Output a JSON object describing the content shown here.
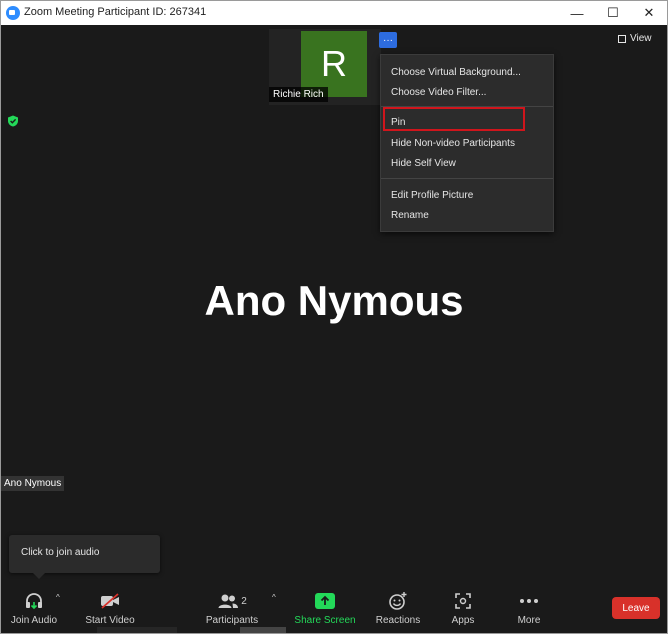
{
  "window": {
    "title": "Zoom Meeting Participant ID: 267341",
    "controls": {
      "minimize": "—",
      "maximize": "☐",
      "close": "✕"
    }
  },
  "thumbnail": {
    "initial": "R",
    "name": "Richie Rich",
    "more_glyph": "···",
    "tile_color": "#39731f"
  },
  "view_button": {
    "label": "View"
  },
  "context_menu": {
    "items": [
      "Choose Virtual Background...",
      "Choose Video Filter...",
      "Pin",
      "Hide Non-video Participants",
      "Hide Self View",
      "Edit Profile Picture",
      "Rename"
    ],
    "highlight_color": "#d0151c"
  },
  "main_speaker": {
    "name": "Ano Nymous"
  },
  "self_view": {
    "label": "Ano Nymous"
  },
  "audio_tooltip": {
    "text": "Click to join audio"
  },
  "toolbar": {
    "join_audio": "Join Audio",
    "start_video": "Start Video",
    "participants": "Participants",
    "participants_count": "2",
    "share_screen": "Share Screen",
    "reactions": "Reactions",
    "apps": "Apps",
    "more": "More",
    "leave": "Leave",
    "caret": "^",
    "share_color": "#23d959",
    "leave_color": "#d8312a"
  },
  "icons": {
    "security": "shield-icon",
    "audio": "headphones-icon",
    "video": "video-off-icon",
    "participants": "participants-icon",
    "share": "share-screen-icon",
    "reactions": "emoji-icon",
    "apps": "apps-icon",
    "more": "ellipsis-icon"
  }
}
